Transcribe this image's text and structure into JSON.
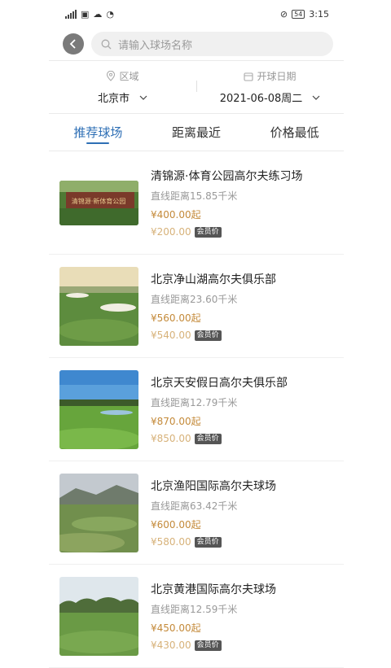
{
  "status_bar": {
    "time": "3:15",
    "battery": "54"
  },
  "search": {
    "placeholder": "请输入球场名称"
  },
  "filters": [
    {
      "label": "区域",
      "value": "北京市",
      "icon": "location-icon"
    },
    {
      "label": "开球日期",
      "value": "2021-06-08周二",
      "icon": "calendar-icon"
    }
  ],
  "tabs": [
    {
      "label": "推荐球场",
      "active": true
    },
    {
      "label": "距离最近",
      "active": false
    },
    {
      "label": "价格最低",
      "active": false
    }
  ],
  "courses": [
    {
      "name": "清锦源·体育公园高尔夫练习场",
      "distance": "直线距离15.85千米",
      "price": "¥400.00起",
      "member_price": "¥200.00",
      "member_label": "会员价",
      "thumb_sign": "清锦源·新体育公园"
    },
    {
      "name": "北京净山湖高尔夫俱乐部",
      "distance": "直线距离23.60千米",
      "price": "¥560.00起",
      "member_price": "¥540.00",
      "member_label": "会员价"
    },
    {
      "name": "北京天安假日高尔夫俱乐部",
      "distance": "直线距离12.79千米",
      "price": "¥870.00起",
      "member_price": "¥850.00",
      "member_label": "会员价"
    },
    {
      "name": "北京渔阳国际高尔夫球场",
      "distance": "直线距离63.42千米",
      "price": "¥600.00起",
      "member_price": "¥580.00",
      "member_label": "会员价"
    },
    {
      "name": "北京黄港国际高尔夫球场",
      "distance": "直线距离12.59千米",
      "price": "¥450.00起",
      "member_price": "¥430.00",
      "member_label": "会员价"
    }
  ]
}
